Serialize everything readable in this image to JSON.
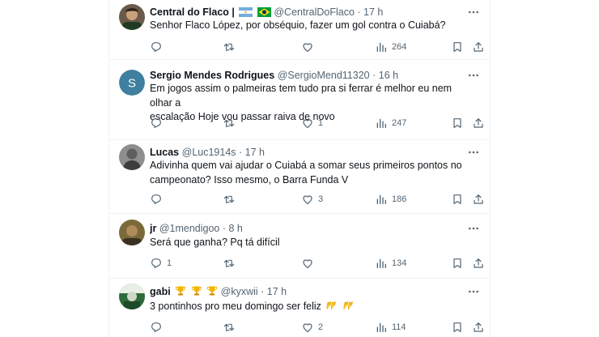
{
  "posts": [
    {
      "display_name": "Central do Flaco |",
      "flags": [
        "argentina-flag-icon",
        "brazil-flag-icon"
      ],
      "handle": "@CentralDoFlaco",
      "time": "· 17 h",
      "text_lines": [
        "Senhor Flaco López, por obséquio, fazer um gol contra o Cuiabá?"
      ],
      "replies": "",
      "retweets": "",
      "likes": "",
      "views": "264",
      "avatar": "photo-avatar"
    },
    {
      "display_name": "Sergio Mendes Rodrigues",
      "handle": "@SergioMend11320",
      "time": "· 16 h",
      "text_lines": [
        "Em jogos assim o palmeiras tem tudo pra si ferrar é melhor eu nem olhar a",
        "escalação Hoje vou passar raiva de novo"
      ],
      "replies": "",
      "retweets": "",
      "likes": "1",
      "views": "247",
      "avatar_letter": "S",
      "avatar_color": "#3f7f9f"
    },
    {
      "display_name": "Lucas",
      "handle": "@Luc1914s",
      "time": "· 17 h",
      "text_lines": [
        "Adivinha quem vai ajudar o Cuiabá a somar seus primeiros pontos no",
        "campeonato? Isso mesmo, o Barra Funda V"
      ],
      "replies": "",
      "retweets": "",
      "likes": "3",
      "views": "186",
      "avatar": "photo-avatar"
    },
    {
      "display_name": "jr",
      "handle": "@1mendigoo",
      "time": "· 8 h",
      "text_lines": [
        "Será que ganha? Pq tá difícil"
      ],
      "replies": "1",
      "retweets": "",
      "likes": "",
      "views": "134",
      "avatar": "photo-avatar"
    },
    {
      "display_name": "gabi",
      "name_emoji": [
        "trophy-icon",
        "trophy-icon",
        "trophy-icon"
      ],
      "handle": "@kyxwii",
      "time": "· 17 h",
      "text_lines": [
        "3 pontinhos pro meu domingo ser feliz"
      ],
      "text_emoji": [
        "raising-hands-icon",
        "raising-hands-icon"
      ],
      "replies": "",
      "retweets": "",
      "likes": "2",
      "views": "114",
      "avatar": "photo-avatar"
    }
  ],
  "colors": {
    "text": "#0f1419",
    "secondary": "#536471",
    "divider": "#eff3f4"
  }
}
